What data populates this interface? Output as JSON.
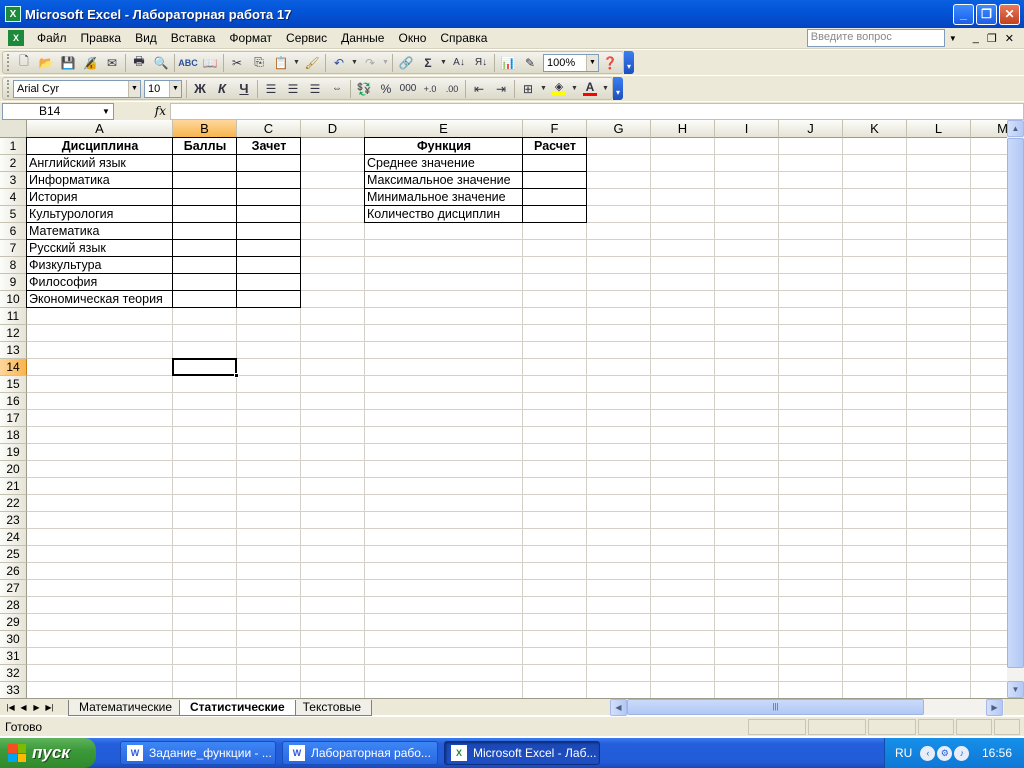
{
  "window": {
    "title": "Microsoft Excel - Лабораторная работа 17",
    "min_icon": "minimize-icon",
    "max_icon": "restore-icon",
    "close_icon": "close-icon"
  },
  "menu": {
    "items": [
      "Файл",
      "Правка",
      "Вид",
      "Вставка",
      "Формат",
      "Сервис",
      "Данные",
      "Окно",
      "Справка"
    ],
    "ask_placeholder": "Введите вопрос"
  },
  "toolbar": {
    "zoom": "100%",
    "font_name": "Arial Cyr",
    "font_size": "10",
    "bold": "Ж",
    "italic": "К",
    "underline": "Ч",
    "percent": "%",
    "thousands": "000",
    "sigma": "Σ",
    "font_color": "#ff0000",
    "fill_color": "#ffff00"
  },
  "formula_bar": {
    "name_box": "B14",
    "fx": "fx",
    "content": ""
  },
  "grid": {
    "columns": [
      "A",
      "B",
      "C",
      "D",
      "E",
      "F",
      "G",
      "H",
      "I",
      "J",
      "K",
      "L",
      "M"
    ],
    "rows": [
      "1",
      "2",
      "3",
      "4",
      "5",
      "6",
      "7",
      "8",
      "9",
      "10",
      "11",
      "12",
      "13",
      "14",
      "15",
      "16",
      "17",
      "18",
      "19",
      "20",
      "21",
      "22",
      "23",
      "24",
      "25",
      "26",
      "27",
      "28",
      "29",
      "30",
      "31",
      "32",
      "33"
    ],
    "selected_cell": "B14",
    "headers": {
      "discipline": "Дисциплина",
      "score": "Баллы",
      "credit": "Зачет",
      "function": "Функция",
      "calc": "Расчет"
    },
    "disciplines": [
      "Английский язык",
      "Информатика",
      "История",
      "Культурология",
      "Математика",
      "Русский язык",
      "Физкультура",
      "Философия",
      "Экономическая теория"
    ],
    "functions": [
      "Среднее значение",
      "Максимальное значение",
      "Минимальное значение",
      "Количество дисциплин"
    ]
  },
  "sheets": {
    "tabs": [
      "Математические",
      "Статистические",
      "Текстовые"
    ],
    "active": "Статистические"
  },
  "status": {
    "text": "Готово"
  },
  "taskbar": {
    "start": "пуск",
    "tasks": [
      "Задание_функции - ...",
      "Лабораторная рабо...",
      "Microsoft Excel - Лаб..."
    ],
    "active_task": 2,
    "lang": "RU",
    "clock": "16:56"
  }
}
